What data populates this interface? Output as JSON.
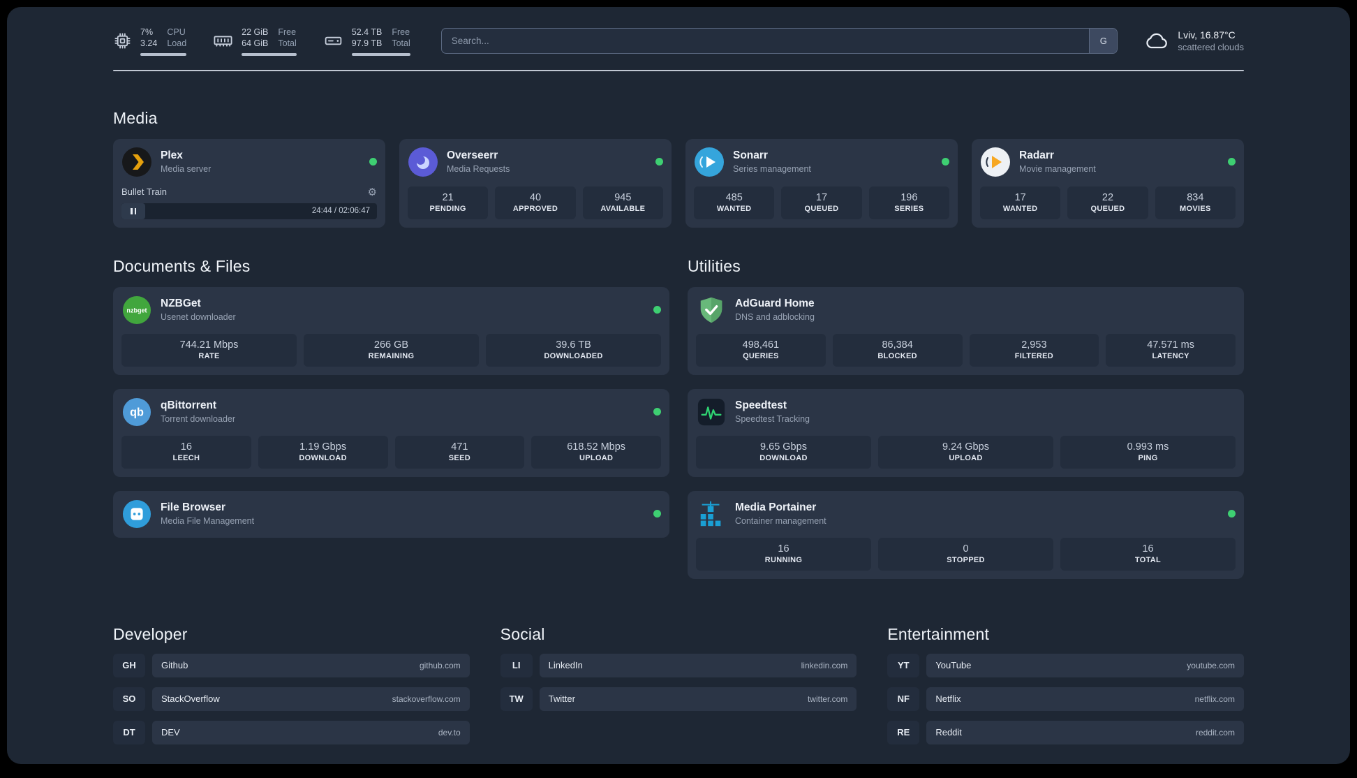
{
  "icons": {
    "gear": "⚙"
  },
  "colors": {
    "status_online": "#3ecf72"
  },
  "topbar": {
    "cpu": {
      "value1": "7%",
      "value2": "3.24",
      "label1": "CPU",
      "label2": "Load"
    },
    "ram": {
      "value1": "22 GiB",
      "value2": "64 GiB",
      "label1": "Free",
      "label2": "Total"
    },
    "disk": {
      "value1": "52.4 TB",
      "value2": "97.9 TB",
      "label1": "Free",
      "label2": "Total"
    },
    "search": {
      "placeholder": "Search...",
      "button_label": "G"
    },
    "weather": {
      "location": "Lviv, 16.87°C",
      "condition": "scattered clouds"
    }
  },
  "sections": {
    "media": {
      "title": "Media"
    },
    "documents": {
      "title": "Documents & Files"
    },
    "utilities": {
      "title": "Utilities"
    }
  },
  "services": {
    "plex": {
      "name": "Plex",
      "description": "Media server",
      "now_playing": "Bullet Train",
      "time": "24:44 / 02:06:47"
    },
    "overseerr": {
      "name": "Overseerr",
      "description": "Media Requests",
      "stats": [
        {
          "value": "21",
          "label": "PENDING"
        },
        {
          "value": "40",
          "label": "APPROVED"
        },
        {
          "value": "945",
          "label": "AVAILABLE"
        }
      ]
    },
    "sonarr": {
      "name": "Sonarr",
      "description": "Series management",
      "stats": [
        {
          "value": "485",
          "label": "WANTED"
        },
        {
          "value": "17",
          "label": "QUEUED"
        },
        {
          "value": "196",
          "label": "SERIES"
        }
      ]
    },
    "radarr": {
      "name": "Radarr",
      "description": "Movie management",
      "stats": [
        {
          "value": "17",
          "label": "WANTED"
        },
        {
          "value": "22",
          "label": "QUEUED"
        },
        {
          "value": "834",
          "label": "MOVIES"
        }
      ]
    },
    "nzbget": {
      "name": "NZBGet",
      "description": "Usenet downloader",
      "icon_text": "nzbget",
      "stats": [
        {
          "value": "744.21 Mbps",
          "label": "RATE"
        },
        {
          "value": "266 GB",
          "label": "REMAINING"
        },
        {
          "value": "39.6 TB",
          "label": "DOWNLOADED"
        }
      ]
    },
    "qbittorrent": {
      "name": "qBittorrent",
      "description": "Torrent downloader",
      "icon_text": "qb",
      "stats": [
        {
          "value": "16",
          "label": "LEECH"
        },
        {
          "value": "1.19 Gbps",
          "label": "DOWNLOAD"
        },
        {
          "value": "471",
          "label": "SEED"
        },
        {
          "value": "618.52 Mbps",
          "label": "UPLOAD"
        }
      ]
    },
    "filebrowser": {
      "name": "File Browser",
      "description": "Media File Management"
    },
    "adguard": {
      "name": "AdGuard Home",
      "description": "DNS and adblocking",
      "stats": [
        {
          "value": "498,461",
          "label": "QUERIES"
        },
        {
          "value": "86,384",
          "label": "BLOCKED"
        },
        {
          "value": "2,953",
          "label": "FILTERED"
        },
        {
          "value": "47.571 ms",
          "label": "LATENCY"
        }
      ]
    },
    "speedtest": {
      "name": "Speedtest",
      "description": "Speedtest Tracking",
      "stats": [
        {
          "value": "9.65 Gbps",
          "label": "DOWNLOAD"
        },
        {
          "value": "9.24 Gbps",
          "label": "UPLOAD"
        },
        {
          "value": "0.993 ms",
          "label": "PING"
        }
      ]
    },
    "portainer": {
      "name": "Media Portainer",
      "description": "Container management",
      "stats": [
        {
          "value": "16",
          "label": "RUNNING"
        },
        {
          "value": "0",
          "label": "STOPPED"
        },
        {
          "value": "16",
          "label": "TOTAL"
        }
      ]
    }
  },
  "bookmarks": {
    "developer": {
      "title": "Developer",
      "items": [
        {
          "abbr": "GH",
          "name": "Github",
          "url": "github.com"
        },
        {
          "abbr": "SO",
          "name": "StackOverflow",
          "url": "stackoverflow.com"
        },
        {
          "abbr": "DT",
          "name": "DEV",
          "url": "dev.to"
        }
      ]
    },
    "social": {
      "title": "Social",
      "items": [
        {
          "abbr": "LI",
          "name": "LinkedIn",
          "url": "linkedin.com"
        },
        {
          "abbr": "TW",
          "name": "Twitter",
          "url": "twitter.com"
        }
      ]
    },
    "entertainment": {
      "title": "Entertainment",
      "items": [
        {
          "abbr": "YT",
          "name": "YouTube",
          "url": "youtube.com"
        },
        {
          "abbr": "NF",
          "name": "Netflix",
          "url": "netflix.com"
        },
        {
          "abbr": "RE",
          "name": "Reddit",
          "url": "reddit.com"
        }
      ]
    }
  }
}
